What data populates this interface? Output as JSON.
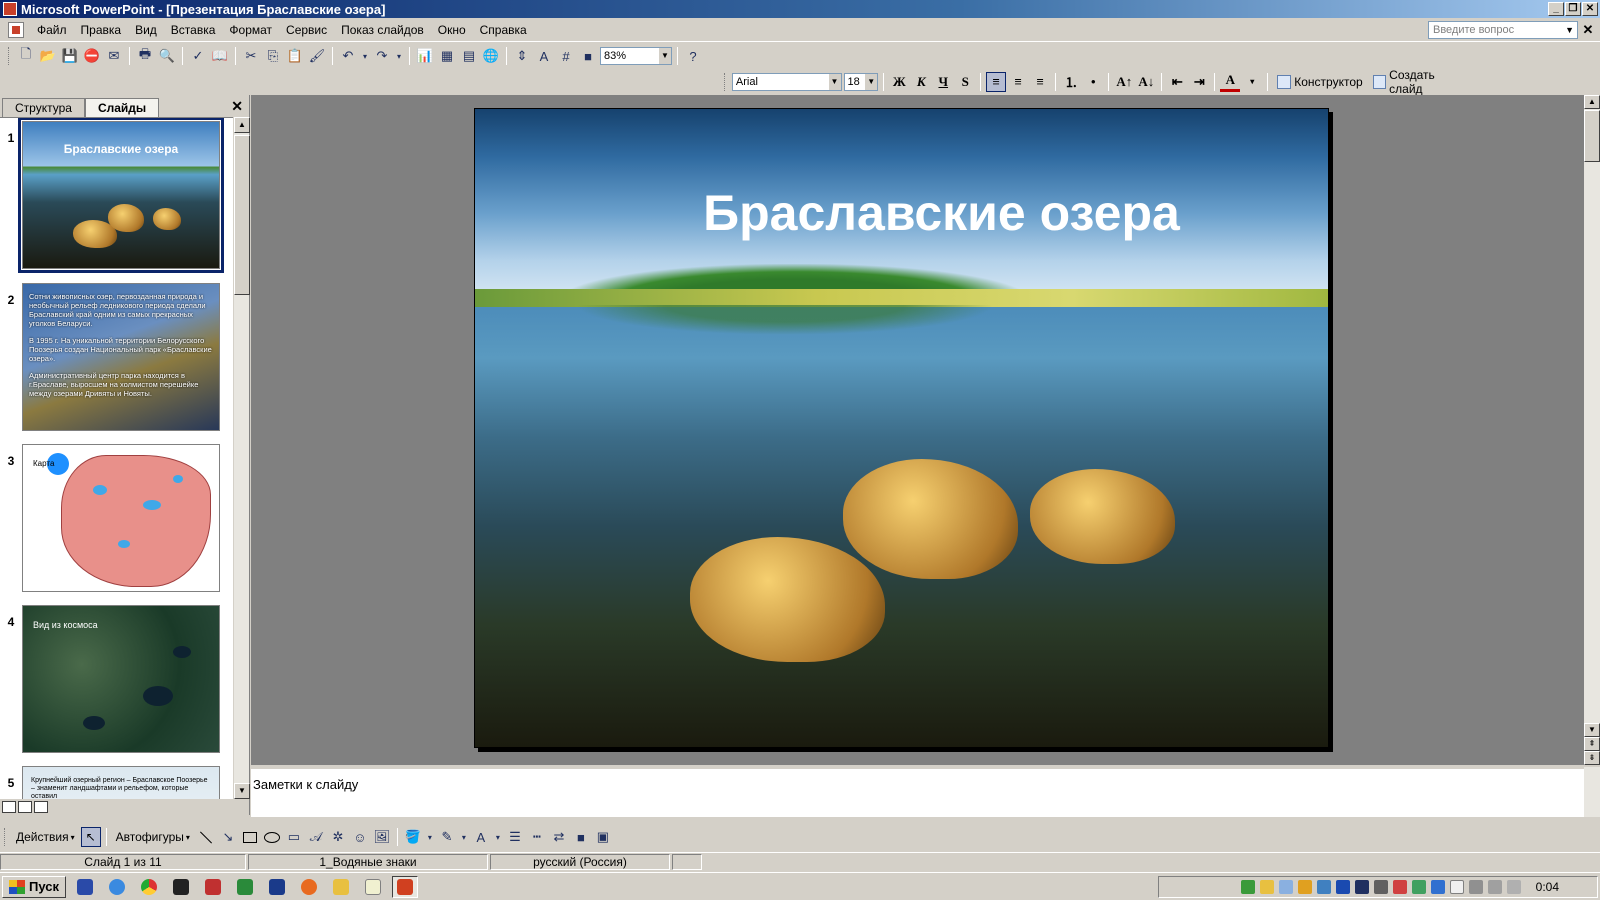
{
  "window": {
    "title": "Microsoft PowerPoint - [Презентация Браславские озера]",
    "buttons": [
      "_",
      "❐",
      "✕"
    ]
  },
  "menu": {
    "items": [
      "Файл",
      "Правка",
      "Вид",
      "Вставка",
      "Формат",
      "Сервис",
      "Показ слайдов",
      "Окно",
      "Справка"
    ],
    "help_placeholder": "Введите вопрос",
    "close": "✕"
  },
  "toolbar_standard": {
    "zoom": "83%"
  },
  "toolbar_formatting": {
    "font": "Arial",
    "size": "18",
    "bold": "Ж",
    "italic": "К",
    "underline": "Ч",
    "shadow": "S",
    "designer": "Конструктор",
    "new_slide": "Создать слайд"
  },
  "left_pane": {
    "tabs": [
      "Структура",
      "Слайды"
    ],
    "active_tab": "Слайды",
    "close": "✕",
    "thumbnails": [
      {
        "num": "1",
        "title": "Браславские озера"
      },
      {
        "num": "2",
        "paragraphs": [
          "Сотни живописных озер, первозданная природа и необычный рельеф ледникового периода сделали Браславский край одним из самых прекрасных уголков Беларуси.",
          "В 1995 г. На уникальной территории Белорусского Поозерья создан Национальный парк «Браславские озера».",
          "Административный центр парка находится в г.Браславе, выросшем на холмистом перешейке между озерами Дривяты и Новяты."
        ]
      },
      {
        "num": "3",
        "label": "Карта"
      },
      {
        "num": "4",
        "label": "Вид из космоса"
      },
      {
        "num": "5",
        "text": "Крупнейший озерный регион – Браславское Поозерье – знаменит ландшафтами и рельефом, которые оставил"
      }
    ]
  },
  "slide": {
    "title": "Браславские озера"
  },
  "notes": {
    "placeholder": "Заметки к слайду"
  },
  "drawing": {
    "actions": "Действия",
    "autoshapes": "Автофигуры"
  },
  "status": {
    "slide": "Слайд 1 из 11",
    "design": "1_Водяные знаки",
    "language": "русский (Россия)"
  },
  "taskbar": {
    "start": "Пуск",
    "clock": "0:04"
  }
}
